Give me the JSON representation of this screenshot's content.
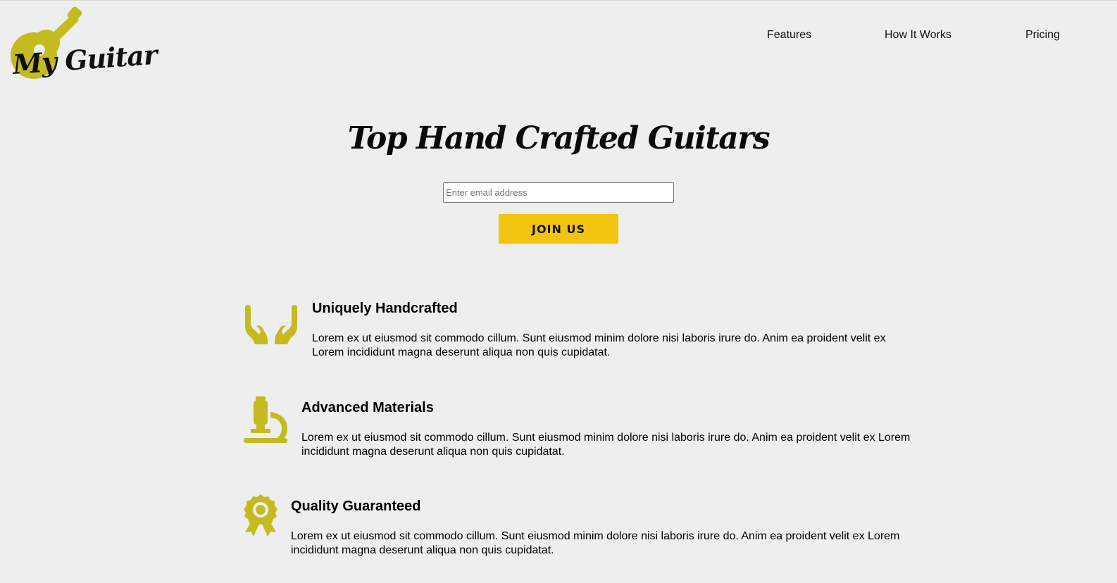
{
  "brand": {
    "name": "My Guitar",
    "accent_color": "#c3bb1f",
    "button_color": "#f1c40f"
  },
  "nav": {
    "items": [
      {
        "label": "Features"
      },
      {
        "label": "How It Works"
      },
      {
        "label": "Pricing"
      }
    ]
  },
  "hero": {
    "title": "Top Hand Crafted Guitars",
    "email_placeholder": "Enter email address",
    "join_label": "JOIN US"
  },
  "features": [
    {
      "icon": "hands-icon",
      "title": "Uniquely Handcrafted",
      "text": "Lorem ex ut eiusmod sit commodo cillum. Sunt eiusmod minim dolore nisi laboris irure do. Anim ea proident velit ex Lorem incididunt magna deserunt aliqua non quis cupidatat."
    },
    {
      "icon": "microscope-icon",
      "title": "Advanced Materials",
      "text": "Lorem ex ut eiusmod sit commodo cillum. Sunt eiusmod minim dolore nisi laboris irure do. Anim ea proident velit ex Lorem incididunt magna deserunt aliqua non quis cupidatat."
    },
    {
      "icon": "award-ribbon-icon",
      "title": "Quality Guaranteed",
      "text": "Lorem ex ut eiusmod sit commodo cillum. Sunt eiusmod minim dolore nisi laboris irure do. Anim ea proident velit ex Lorem incididunt magna deserunt aliqua non quis cupidatat."
    }
  ]
}
